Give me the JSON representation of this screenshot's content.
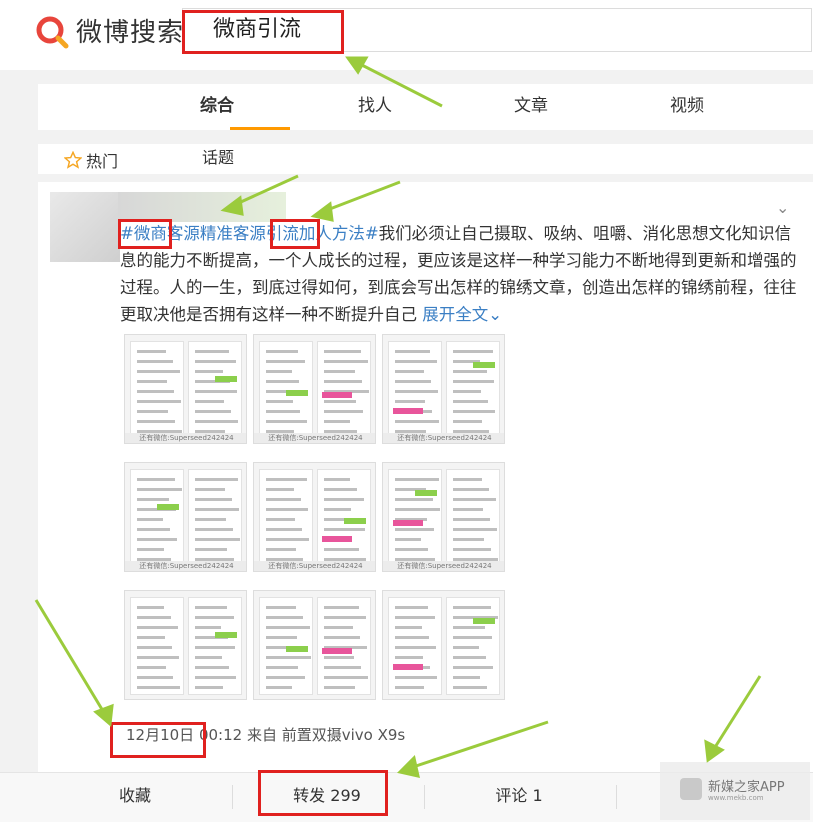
{
  "header": {
    "logo_text": "微博搜索",
    "search_value": "微商引流"
  },
  "tabs": [
    {
      "label": "综合",
      "active": true
    },
    {
      "label": "找人",
      "active": false
    },
    {
      "label": "文章",
      "active": false
    },
    {
      "label": "视频",
      "active": false
    }
  ],
  "subtabs": {
    "hot": "热门",
    "topic": "话题"
  },
  "post": {
    "hashtag": "#微商客源精准客源引流加人方法#",
    "body": "我们必须让自己摄取、吸纳、咀嚼、消化思想文化知识信息的能力不断提高，一个人成长的过程，更应该是这样一种学习能力不断地得到更新和增强的过程。人的一生，到底过得如何，到底会写出怎样的锦绣文章，创造出怎样的锦绣前程，往往更取决他是否拥有这样一种不断提升自己",
    "expand": "展开全文",
    "image_caption": "还有微信:Superseed242424",
    "date": "12月10日",
    "meta_rest": " 00:12 来自 前置双摄vivo X9s"
  },
  "actions": {
    "favorite": "收藏",
    "repost": "转发 299",
    "comment": "评论 1"
  },
  "watermark": {
    "name": "新媒之家APP",
    "url": "www.mekb.com"
  },
  "colors": {
    "accent": "#f90",
    "hashtag": "#eb7350",
    "link": "#3b7fc4",
    "annotation_red": "#e0211f",
    "annotation_green": "#9bcb3c"
  }
}
